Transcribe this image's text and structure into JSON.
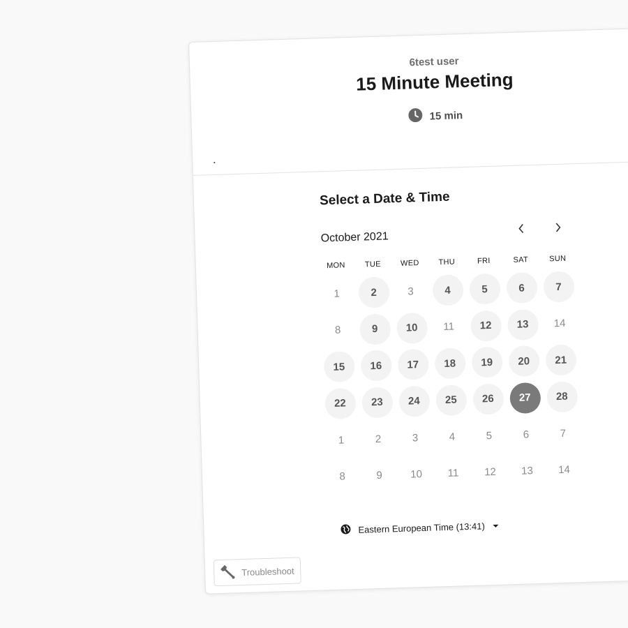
{
  "event": {
    "owner": "6test user",
    "title": "15 Minute Meeting",
    "duration": "15 min"
  },
  "calendar": {
    "section_title": "Select a Date & Time",
    "month_label": "October 2021",
    "weekdays": [
      "MON",
      "TUE",
      "WED",
      "THU",
      "FRI",
      "SAT",
      "SUN"
    ],
    "days": [
      {
        "label": "1",
        "state": "disabled"
      },
      {
        "label": "2",
        "state": "available"
      },
      {
        "label": "3",
        "state": "disabled"
      },
      {
        "label": "4",
        "state": "available"
      },
      {
        "label": "5",
        "state": "available"
      },
      {
        "label": "6",
        "state": "available"
      },
      {
        "label": "7",
        "state": "available"
      },
      {
        "label": "8",
        "state": "disabled"
      },
      {
        "label": "9",
        "state": "available"
      },
      {
        "label": "10",
        "state": "available"
      },
      {
        "label": "11",
        "state": "disabled"
      },
      {
        "label": "12",
        "state": "available"
      },
      {
        "label": "13",
        "state": "available"
      },
      {
        "label": "14",
        "state": "disabled"
      },
      {
        "label": "15",
        "state": "available"
      },
      {
        "label": "16",
        "state": "available"
      },
      {
        "label": "17",
        "state": "available"
      },
      {
        "label": "18",
        "state": "available"
      },
      {
        "label": "19",
        "state": "available"
      },
      {
        "label": "20",
        "state": "available"
      },
      {
        "label": "21",
        "state": "available"
      },
      {
        "label": "22",
        "state": "available"
      },
      {
        "label": "23",
        "state": "available"
      },
      {
        "label": "24",
        "state": "available"
      },
      {
        "label": "25",
        "state": "available"
      },
      {
        "label": "26",
        "state": "available"
      },
      {
        "label": "27",
        "state": "selected"
      },
      {
        "label": "28",
        "state": "available"
      },
      {
        "label": "1",
        "state": "disabled"
      },
      {
        "label": "2",
        "state": "disabled"
      },
      {
        "label": "3",
        "state": "disabled"
      },
      {
        "label": "4",
        "state": "disabled"
      },
      {
        "label": "5",
        "state": "disabled"
      },
      {
        "label": "6",
        "state": "disabled"
      },
      {
        "label": "7",
        "state": "disabled"
      },
      {
        "label": "8",
        "state": "disabled"
      },
      {
        "label": "9",
        "state": "disabled"
      },
      {
        "label": "10",
        "state": "disabled"
      },
      {
        "label": "11",
        "state": "disabled"
      },
      {
        "label": "12",
        "state": "disabled"
      },
      {
        "label": "13",
        "state": "disabled"
      },
      {
        "label": "14",
        "state": "disabled"
      }
    ]
  },
  "timezone": {
    "label": "Eastern European Time (13:41)"
  },
  "footer": {
    "troubleshoot_label": "Troubleshoot"
  },
  "icons": {
    "duration": "clock-icon",
    "prev": "chevron-left-icon",
    "next": "chevron-right-icon",
    "timezone": "globe-icon",
    "troubleshoot": "wrench-icon"
  },
  "colors": {
    "selected_day": "#7a7a7a",
    "available_day": "#f3f3f3",
    "corner_ribbon": "#666666"
  }
}
